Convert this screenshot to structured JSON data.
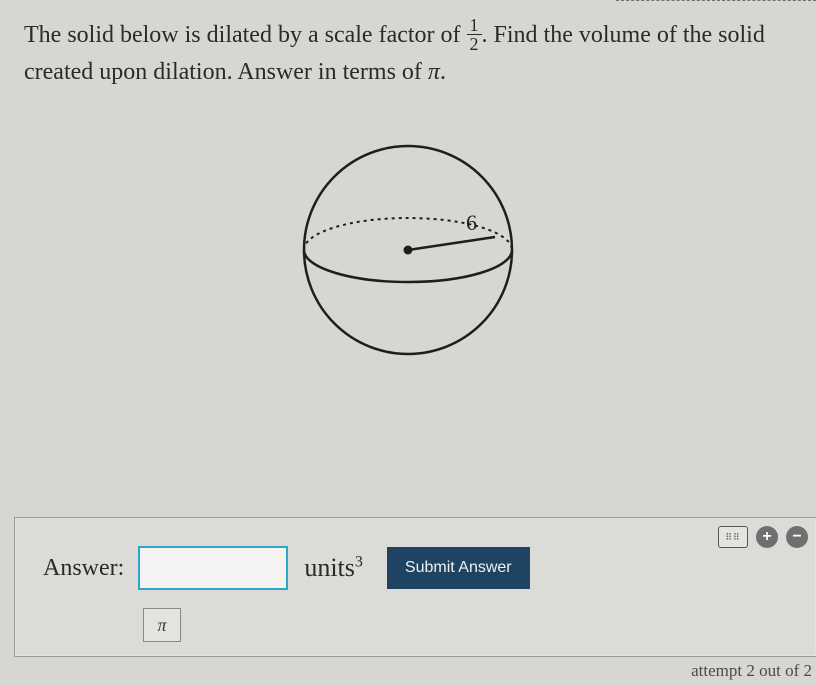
{
  "question": {
    "part1": "The solid below is dilated by a scale factor of ",
    "frac_num": "1",
    "frac_den": "2",
    "part2": ". Find the volume of the solid created upon dilation. Answer in terms of ",
    "pi": "π",
    "part3": "."
  },
  "figure": {
    "radius_label": "6"
  },
  "answer": {
    "label": "Answer:",
    "value": "",
    "units_base": "units",
    "units_exp": "3",
    "submit_label": "Submit Answer",
    "pi_button": "π"
  },
  "toolbar": {
    "plus": "+",
    "minus": "−"
  },
  "footer": {
    "attempt": "attempt 2 out of 2"
  }
}
